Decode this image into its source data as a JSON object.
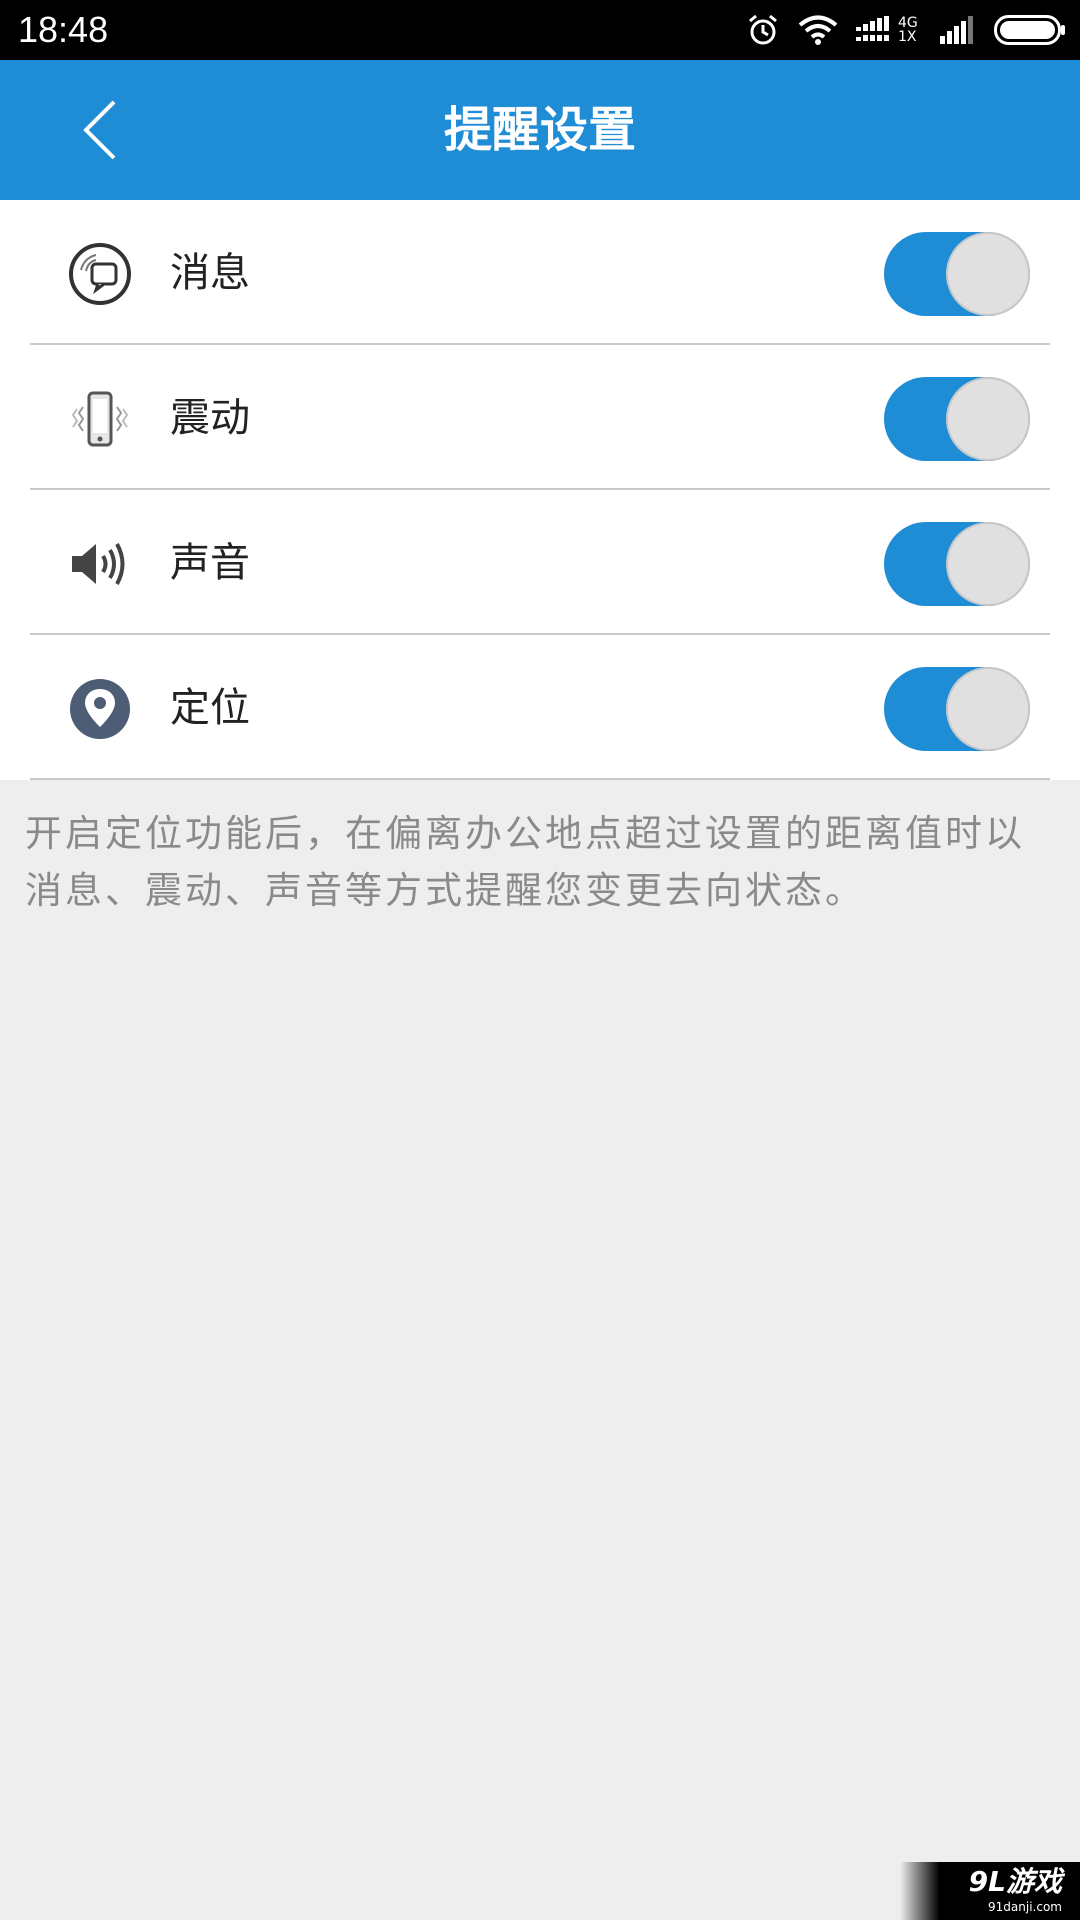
{
  "status_bar": {
    "time": "18:48",
    "network_type_top": "4G",
    "network_type_bottom": "1X",
    "icons": [
      "alarm-icon",
      "wifi-icon",
      "signal-icon",
      "signal-icon",
      "battery-icon"
    ]
  },
  "header": {
    "title": "提醒设置",
    "back_icon": "chevron-left-icon"
  },
  "settings": {
    "items": [
      {
        "label": "消息",
        "icon": "message-bubble-icon",
        "enabled": true
      },
      {
        "label": "震动",
        "icon": "vibrate-phone-icon",
        "enabled": true
      },
      {
        "label": "声音",
        "icon": "speaker-icon",
        "enabled": true
      },
      {
        "label": "定位",
        "icon": "location-pin-icon",
        "enabled": true
      }
    ]
  },
  "description": "开启定位功能后，在偏离办公地点超过设置的距离值时以消息、震动、声音等方式提醒您变更去向状态。",
  "watermark": {
    "logo": "9L游戏",
    "url": "91danji.com"
  },
  "colors": {
    "accent": "#1f8dd6",
    "background": "#eeeeee",
    "toggle_knob": "#e0e0e0",
    "status_bar": "#000000"
  }
}
